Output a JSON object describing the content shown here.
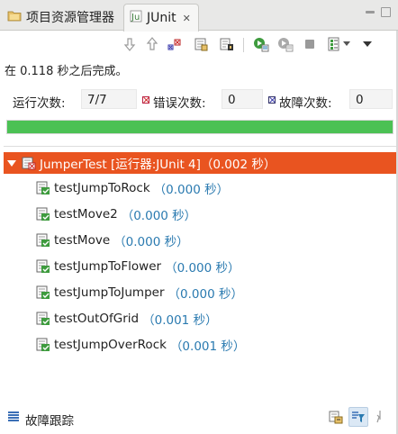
{
  "tabs": {
    "project_label": "项目资源管理器",
    "junit_label": "JUnit",
    "close_glyph": "✕"
  },
  "status": "在 0.118 秒之后完成。",
  "counters": {
    "runs_label": "运行次数:",
    "runs_value": "7/7",
    "errors_label": "错误次数:",
    "errors_value": "0",
    "failures_label": "故障次数:",
    "failures_value": "0"
  },
  "progress": {
    "fraction": 1.0,
    "color": "#4bc154"
  },
  "tree": {
    "root_label": "JumperTest [运行器:JUnit 4]（0.002 秒）",
    "root_color": "#e95420",
    "items": [
      {
        "name": "testJumpToRock",
        "time": "（0.000 秒）"
      },
      {
        "name": "testMove2",
        "time": "（0.000 秒）"
      },
      {
        "name": "testMove",
        "time": "（0.000 秒）"
      },
      {
        "name": "testJumpToFlower",
        "time": "（0.000 秒）"
      },
      {
        "name": "testJumpToJumper",
        "time": "（0.000 秒）"
      },
      {
        "name": "testOutOfGrid",
        "time": "（0.001 秒）"
      },
      {
        "name": "testJumpOverRock",
        "time": "（0.001 秒）"
      }
    ]
  },
  "failure_trace": {
    "label": "故障跟踪"
  },
  "icons": {
    "toolbar": [
      "next-failure-icon",
      "previous-failure-icon",
      "show-failures-only-icon",
      "scroll-lock-icon",
      "show-skipped-icon",
      "rerun-icon",
      "rerun-failed-first-icon",
      "stop-icon",
      "history-icon",
      "view-menu-icon"
    ],
    "bottom": [
      "filter-stack-trace-icon",
      "compare-result-icon"
    ]
  }
}
